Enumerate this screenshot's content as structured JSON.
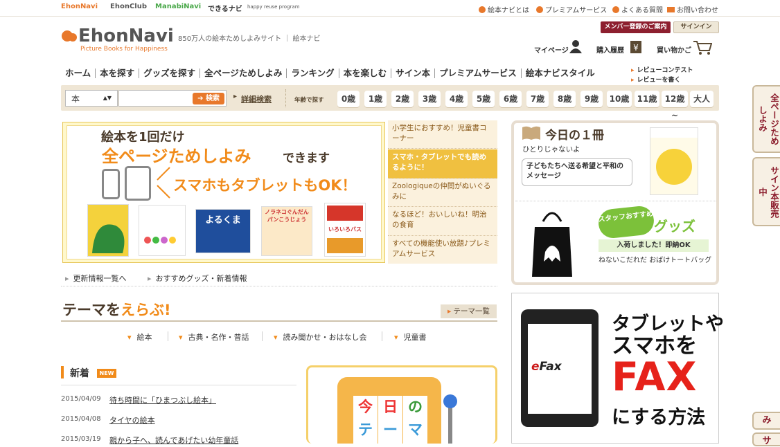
{
  "topbar": {
    "brands": [
      "EhonNavi",
      "EhonClub",
      "ManabiNavi",
      "できるナビ",
      "happy reuse program"
    ],
    "links": [
      "絵本ナビとは",
      "プレミアムサービス",
      "よくある質問",
      "お問い合わせ"
    ]
  },
  "header": {
    "logo": "EhonNavi",
    "logo_sub": "Picture Books for Happiness",
    "tagline": "850万人の絵本ためしよみサイト ｜ 絵本ナビ",
    "member_button": "メンバー登録のご案内",
    "signin_button": "サインイン",
    "mypage": "マイページ",
    "history": "購入履歴",
    "cart": "買い物かご"
  },
  "nav": {
    "items": [
      "ホーム",
      "本を探す",
      "グッズを探す",
      "全ページためしよみ",
      "ランキング",
      "本を楽しむ",
      "サイン本",
      "プレミアムサービス",
      "絵本ナビスタイル"
    ],
    "sub": [
      "レビューコンテスト",
      "レビューを書く"
    ]
  },
  "search": {
    "category": "本",
    "placeholder": "",
    "button": "検索",
    "advanced": "詳細検索",
    "age_label": "年齢で探す",
    "ages": [
      "0歳",
      "1歳",
      "2歳",
      "3歳",
      "4歳",
      "5歳",
      "6歳",
      "7歳",
      "8歳",
      "9歳",
      "10歳",
      "11歳",
      "12歳~",
      "大人"
    ]
  },
  "promo": {
    "line1": "絵本を1回だけ",
    "line2": "全ページためしよみ",
    "line2b": "できます",
    "line3": "スマホもタブレットもOK！",
    "book_titles": [
      "よるくま",
      "ノラネコぐんだん パンこうじょう",
      "いろいろバス"
    ]
  },
  "side_list": [
    "小学生におすすめ！児童書コーナー",
    "スマホ・タブレットでも読めるように！",
    "Zoologiqueの仲間がぬいぐるみに",
    "なるほど！おいしいね！明治の食育",
    "すべての機能使い放題♪プレミアムサービス"
  ],
  "today": {
    "title": "今日の１冊",
    "book": "ひとりじゃないよ",
    "message": "子どもたちへ送る希望と平和のメッセージ",
    "staff_badge": "スタッフおすすめ",
    "goods_label": "グッズ",
    "goods_new": "入荷しました！即納OK",
    "goods_name": "ねないこだれだ おばけトートバッグ"
  },
  "links": [
    "更新情報一覧へ",
    "おすすめグッズ・新着情報"
  ],
  "theme": {
    "head_a": "テーマを",
    "head_b": "えらぶ!",
    "list_button": "テーマ一覧",
    "cats": [
      "絵本",
      "古典・名作・昔話",
      "読み聞かせ・おはなし会",
      "児童書"
    ]
  },
  "news": {
    "title": "新着",
    "badge": "NEW",
    "items": [
      {
        "date": "2015/04/09",
        "text": "待ち時間に「ひまつぶし絵本」"
      },
      {
        "date": "2015/04/08",
        "text": "タイヤの絵本"
      },
      {
        "date": "2015/03/19",
        "text": "親から子へ、読んであげたい幼年童話"
      }
    ]
  },
  "slot": {
    "cells": [
      "今",
      "日",
      "の"
    ],
    "cells2": [
      "テ",
      "ー",
      "マ"
    ]
  },
  "efax": {
    "logo_a": "e",
    "logo_b": "Fax",
    "line1": "タブレットや",
    "line2": "スマホを",
    "line3": "FAX",
    "line4": "にする方法"
  },
  "right_tabs": [
    "全ページためしよみ",
    "サイン本販売中",
    "み",
    "サ"
  ],
  "colors": {
    "accent": "#f18b1a",
    "member": "#8d1f2f",
    "green": "#7cc13a"
  }
}
